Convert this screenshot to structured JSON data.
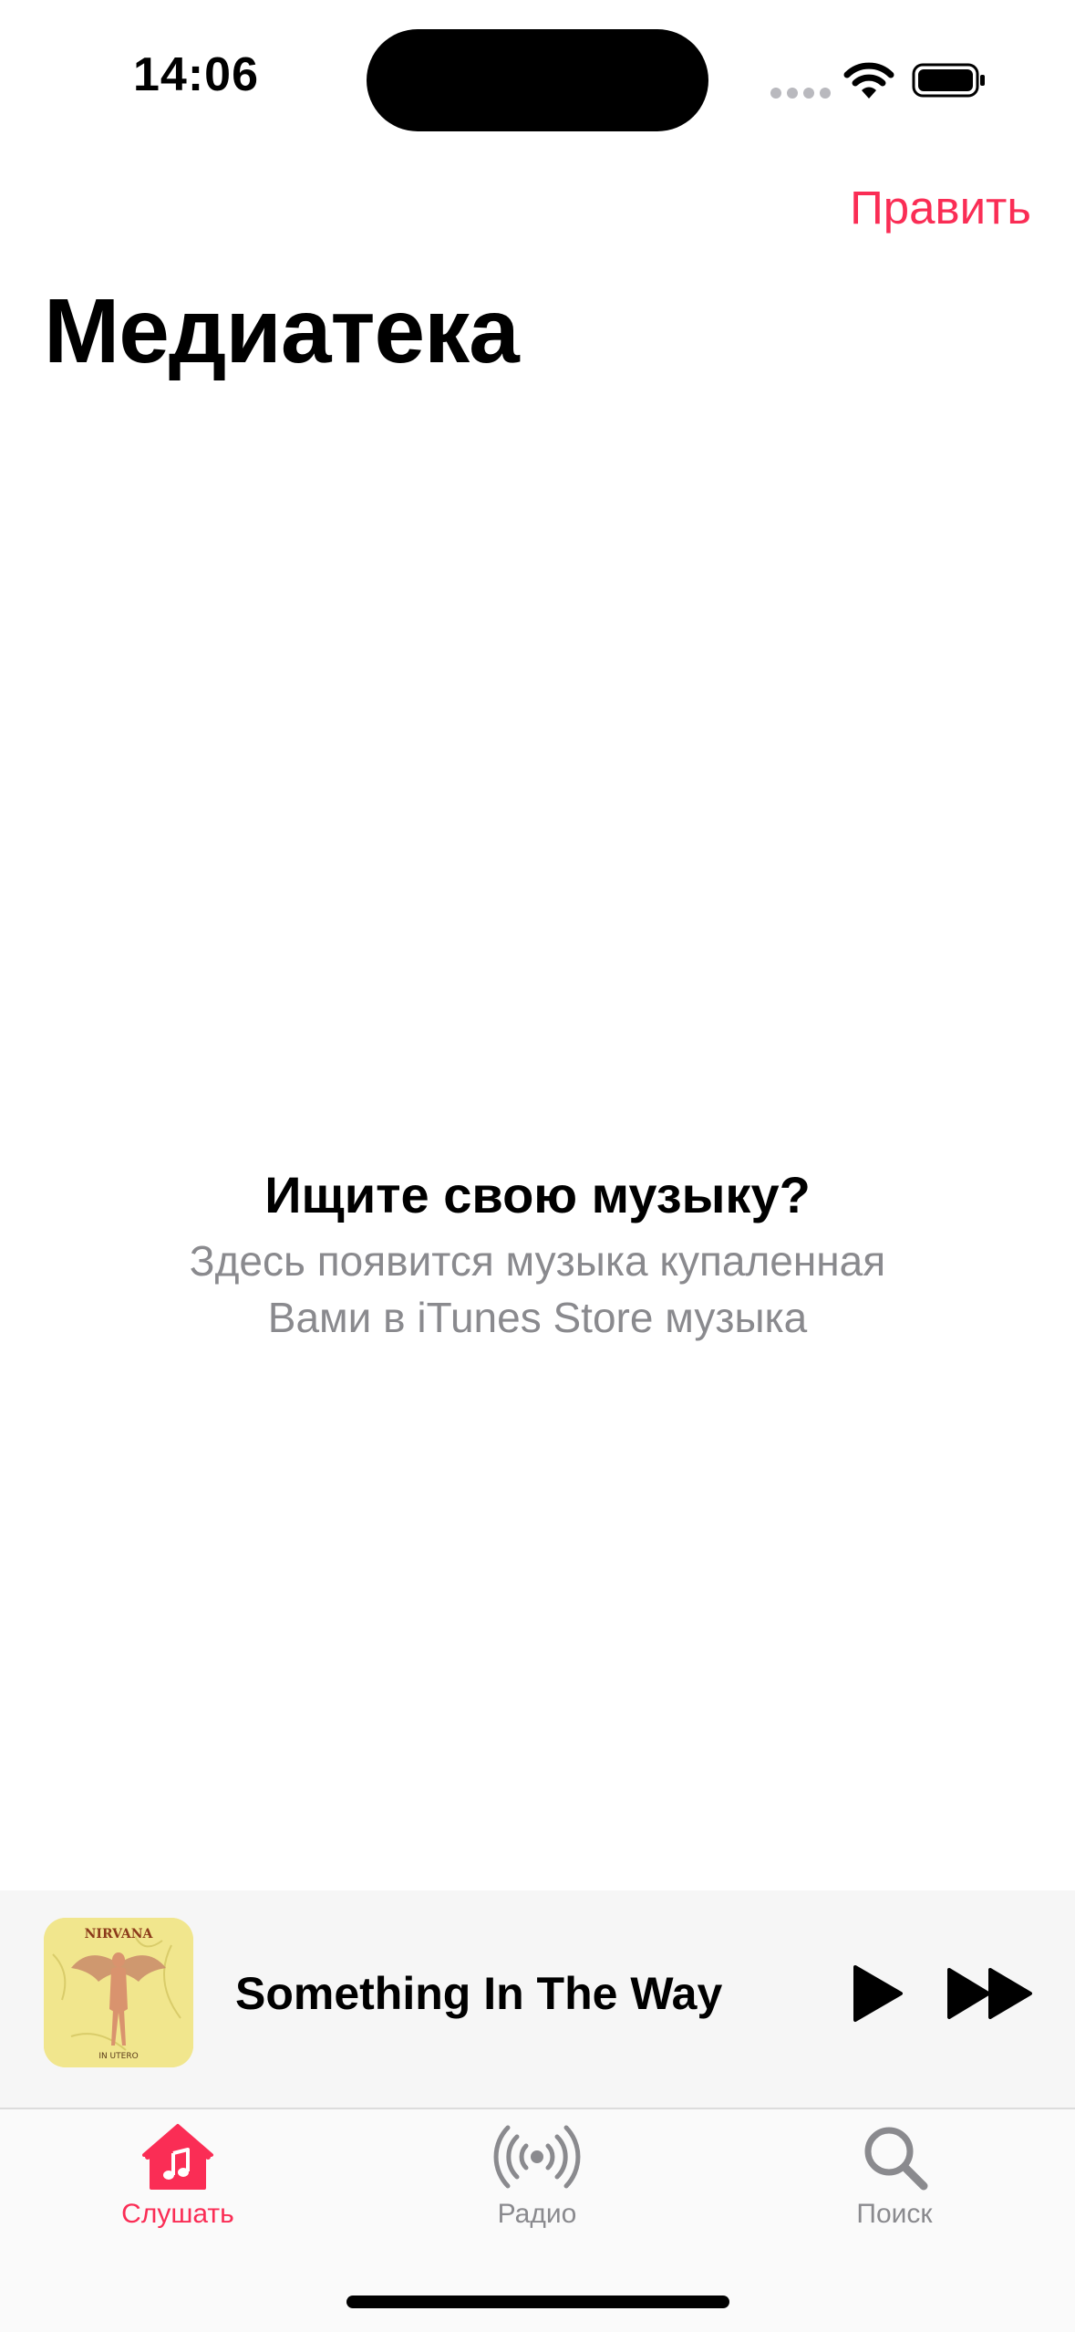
{
  "status_bar": {
    "time": "14:06",
    "icons": [
      "signal-dots-icon",
      "wifi-icon",
      "battery-icon"
    ]
  },
  "nav": {
    "edit_label": "Править"
  },
  "page": {
    "title": "Медиатека"
  },
  "empty_state": {
    "title": "Ищите свою музыку?",
    "subtitle_line1": "Здесь появится музыка купаленная",
    "subtitle_line2": "Вами в iTunes Store музыка"
  },
  "mini_player": {
    "track_title": "Something In The Way",
    "album_art": {
      "band": "NIRVANA",
      "album": "IN UTERO"
    },
    "controls": [
      "play-icon",
      "fast-forward-icon"
    ]
  },
  "tab_bar": {
    "tabs": [
      {
        "label": "Слушать",
        "icon": "home-music-icon",
        "active": true
      },
      {
        "label": "Радио",
        "icon": "radio-icon",
        "active": false
      },
      {
        "label": "Поиск",
        "icon": "search-icon",
        "active": false
      }
    ]
  },
  "colors": {
    "accent": "#fa2d55",
    "secondary_text": "#8a8a8e",
    "mini_player_bg": "#f6f6f6"
  }
}
